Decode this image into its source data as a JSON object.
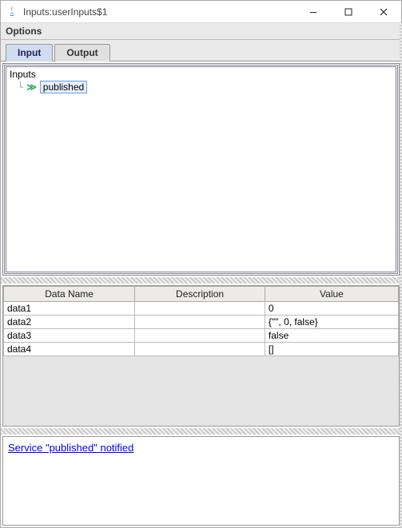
{
  "window": {
    "title": "Inputs:userInputs$1"
  },
  "menubar": {
    "options_label": "Options"
  },
  "tabs": [
    {
      "label": "Input",
      "active": true
    },
    {
      "label": "Output",
      "active": false
    }
  ],
  "tree": {
    "root": "Inputs",
    "nodes": [
      {
        "label": "published",
        "selected": true
      }
    ]
  },
  "table": {
    "headers": {
      "col0": "Data Name",
      "col1": "Description",
      "col2": "Value"
    },
    "rows": [
      {
        "name": "data1",
        "description": "",
        "value": "0"
      },
      {
        "name": "data2",
        "description": "",
        "value": "{\"\", 0, false}"
      },
      {
        "name": "data3",
        "description": "",
        "value": "false"
      },
      {
        "name": "data4",
        "description": "",
        "value": "[]"
      }
    ]
  },
  "log": {
    "message": "Service \"published\" notified"
  }
}
